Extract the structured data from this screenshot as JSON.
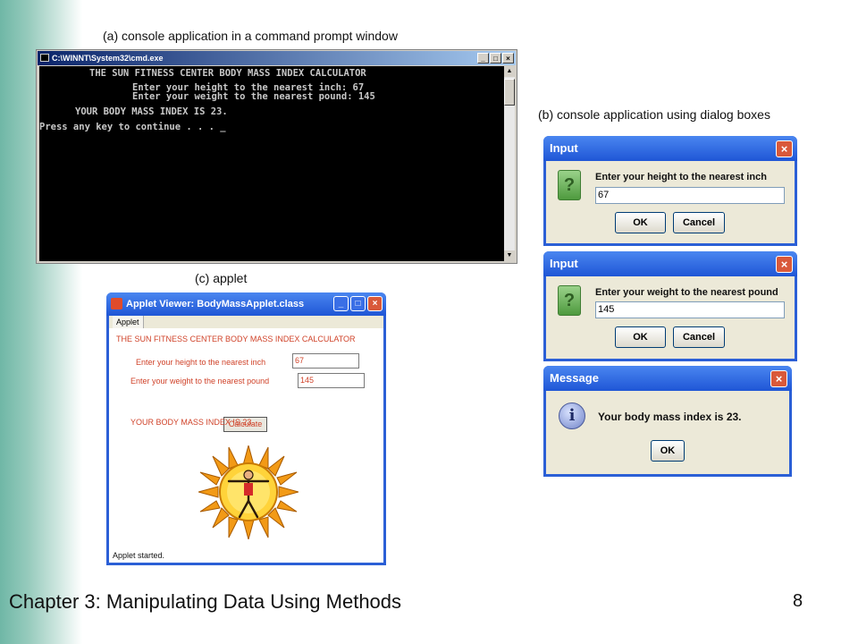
{
  "captions": {
    "a": "(a) console application in a command prompt window",
    "b": "(b) console application using dialog boxes",
    "c": "(c) applet"
  },
  "cmd": {
    "title": "C:\\WINNT\\System32\\cmd.exe",
    "lines": [
      "THE SUN FITNESS CENTER BODY MASS INDEX CALCULATOR",
      "Enter your height to the nearest inch: 67",
      "Enter your weight to the nearest pound: 145",
      "YOUR BODY MASS INDEX IS 23.",
      "Press any key to continue . . . _"
    ]
  },
  "dialogs": {
    "input1": {
      "title": "Input",
      "prompt": "Enter your height to the nearest inch",
      "value": "67",
      "ok": "OK",
      "cancel": "Cancel"
    },
    "input2": {
      "title": "Input",
      "prompt": "Enter your weight to the nearest pound",
      "value": "145",
      "ok": "OK",
      "cancel": "Cancel"
    },
    "message": {
      "title": "Message",
      "text": "Your body mass index is 23.",
      "ok": "OK"
    }
  },
  "applet": {
    "title": "Applet Viewer: BodyMassApplet.class",
    "menu": "Applet",
    "heading": "THE SUN FITNESS CENTER BODY MASS INDEX CALCULATOR",
    "height_label": "Enter your height to the nearest inch",
    "height_value": "67",
    "weight_label": "Enter your weight to the nearest pound",
    "weight_value": "145",
    "calculate": "Calculate",
    "result": "YOUR BODY MASS INDEX IS 23.",
    "status": "Applet started."
  },
  "footer": {
    "title": "Chapter 3: Manipulating Data Using Methods",
    "page": "8"
  },
  "colors": {
    "applet_text": "#d0432a",
    "titlebar": "#2b5fd6",
    "side_band": "#6fb7a6"
  }
}
